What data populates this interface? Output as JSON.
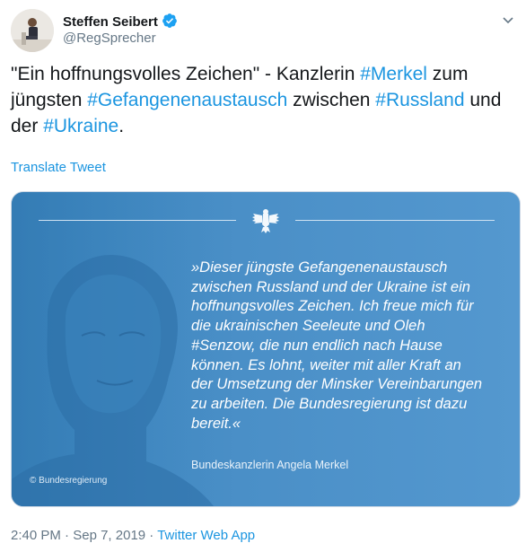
{
  "author": {
    "name": "Steffen Seibert",
    "handle": "@RegSprecher"
  },
  "tweet": {
    "pre": "\"Ein hoffnungsvolles Zeichen\" - Kanzlerin ",
    "tag1": "#Merkel",
    "mid1": " zum jüngsten ",
    "tag2": "#Gefangenenaustausch",
    "mid2": " zwischen ",
    "tag3": "#Russland",
    "mid3": " und der ",
    "tag4": "#Ukraine",
    "post": "."
  },
  "translate_label": "Translate Tweet",
  "card": {
    "quote_lines": [
      "»Dieser jüngste Gefangenenaustausch",
      "zwischen Russland und der Ukraine ist ein",
      "hoffnungsvolles Zeichen. Ich freue mich für",
      "die ukrainischen Seeleute und Oleh",
      "#Senzow, die nun endlich nach Hause",
      "können. Es lohnt, weiter mit aller Kraft an",
      "der Umsetzung der Minsker Vereinbarungen",
      "zu arbeiten. Die Bundesregierung ist dazu",
      "bereit.«"
    ],
    "signature": "Bundeskanzlerin Angela Merkel",
    "copyright": "© Bundesregierung"
  },
  "meta": {
    "time": "2:40 PM",
    "sep1": " · ",
    "date": "Sep 7, 2019",
    "sep2": " · ",
    "app": "Twitter Web App"
  },
  "colors": {
    "link": "#1b95e0",
    "card_blue": "#4a8fc7",
    "verified": "#1da1f2"
  },
  "icons": [
    "verified-badge-icon",
    "chevron-down-icon",
    "federal-eagle-icon"
  ]
}
